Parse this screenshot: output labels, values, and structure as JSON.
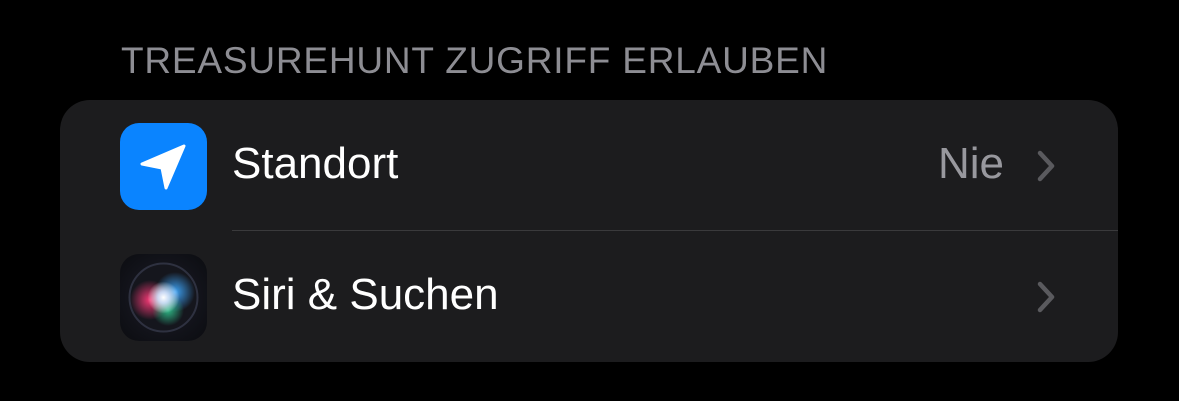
{
  "section": {
    "header": "TREASUREHUNT ZUGRIFF ERLAUBEN"
  },
  "rows": [
    {
      "label": "Standort",
      "value": "Nie",
      "icon": "location-arrow-icon",
      "icon_color": "#0a84ff"
    },
    {
      "label": "Siri & Suchen",
      "icon": "siri-icon"
    }
  ],
  "colors": {
    "background": "#000000",
    "group_background": "#1c1c1e",
    "header_text": "#8d8d93",
    "value_text": "#98989e",
    "chevron": "#5a5a5e",
    "separator": "#3a3a3c"
  }
}
